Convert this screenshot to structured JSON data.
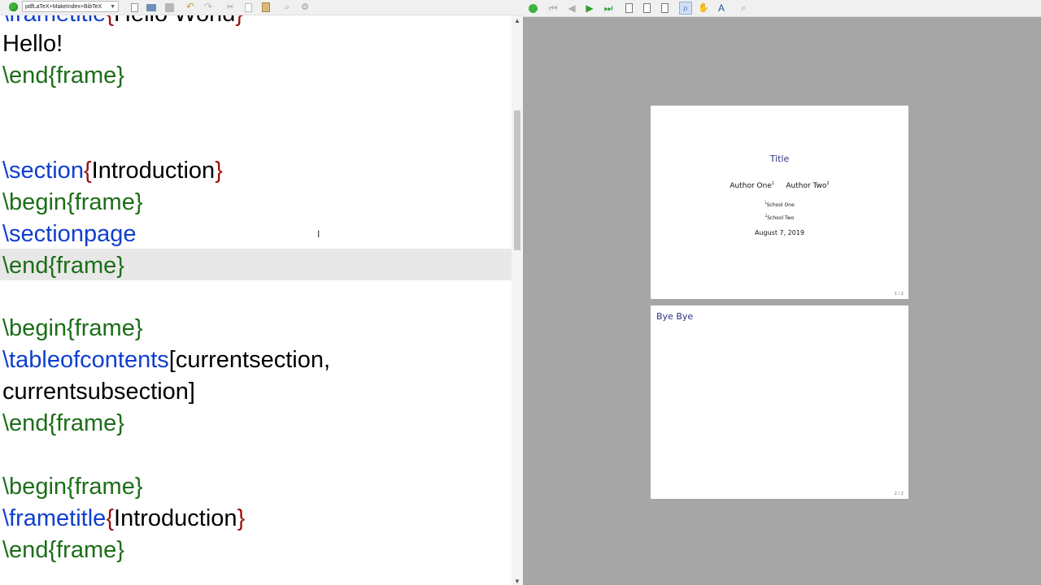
{
  "toolbar": {
    "compiler_label": "pdfLaTeX+MakeIndex+BibTeX",
    "icons": [
      "run-icon",
      "new-file-icon",
      "open-folder-icon",
      "save-icon",
      "undo-icon",
      "redo-icon",
      "cut-icon",
      "copy-icon",
      "paste-icon",
      "find-icon",
      "replace-icon"
    ]
  },
  "viewer_toolbar": {
    "icons": [
      "refresh-icon",
      "first-page-icon",
      "previous-page-icon",
      "next-page-icon",
      "last-page-icon",
      "single-page-icon",
      "double-page-icon",
      "fit-page-icon",
      "zoom-icon",
      "hand-tool-icon",
      "text-select-icon",
      "find-icon"
    ]
  },
  "editor": {
    "partial_top": {
      "cmd": "\\frametitle",
      "open": "{",
      "arg": "Hello World",
      "close": "}"
    },
    "hello_line": "Hello!",
    "end_frame_1": "\\end{frame}",
    "section_cmd": "\\section",
    "section_arg": "Introduction",
    "begin_frame_1": "\\begin{frame}",
    "sectionpage_cmd": "\\sectionpage",
    "end_frame_2": "\\end{frame}",
    "begin_frame_2": "\\begin{frame}",
    "toc_cmd": "\\tableofcontents",
    "toc_opt_1": "[currentsection,",
    "toc_opt_2": "currentsubsection]",
    "end_frame_3": "\\end{frame}",
    "begin_frame_3": "\\begin{frame}",
    "frametitle_cmd": "\\frametitle",
    "frametitle_arg": "Introduction",
    "end_frame_4": "\\end{frame}"
  },
  "preview": {
    "page1": {
      "title": "Title",
      "author1": "Author One",
      "author1_sup": "1",
      "author2": "Author Two",
      "author2_sup": "2",
      "school1_sup": "1",
      "school1": "School One",
      "school2_sup": "2",
      "school2": "School Two",
      "date": "August 7, 2019",
      "page_number": "1 / 2"
    },
    "page2": {
      "frametitle": "Bye Bye",
      "page_number": "2 / 2"
    }
  }
}
